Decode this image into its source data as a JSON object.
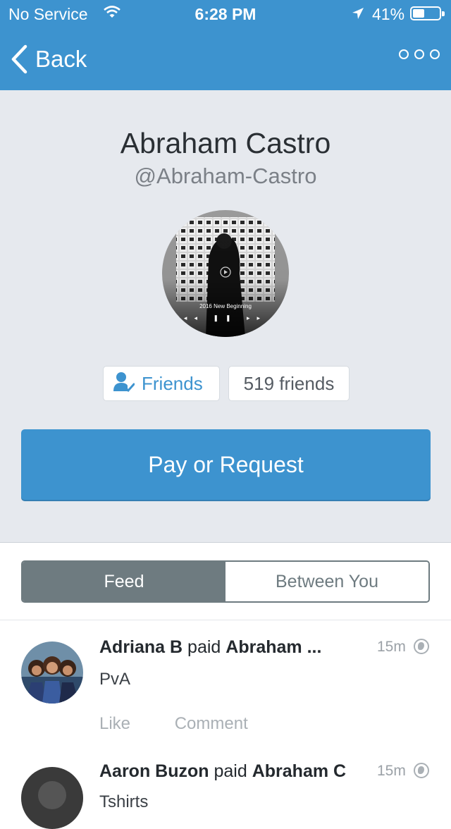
{
  "status_bar": {
    "carrier": "No Service",
    "time": "6:28 PM",
    "battery": "41%",
    "battery_level": 0.41
  },
  "nav": {
    "back_label": "Back",
    "more_icon": "more-options-icon"
  },
  "profile": {
    "name": "Abraham Castro",
    "username": "@Abraham-Castro",
    "photo_caption": "2016 New Beginning",
    "friends_button_label": "Friends",
    "friends_count_label": "519 friends"
  },
  "pay_button_label": "Pay or Request",
  "tabs": [
    {
      "label": "Feed",
      "active": true
    },
    {
      "label": "Between You",
      "active": false
    }
  ],
  "feed": [
    {
      "actor": "Adriana B",
      "verb": "paid",
      "target": "Abraham ...",
      "time": "15m",
      "note": "PvA",
      "like_label": "Like",
      "comment_label": "Comment"
    },
    {
      "actor": "Aaron Buzon",
      "verb": "paid",
      "target": "Abraham C",
      "time": "15m",
      "note": "Tshirts"
    }
  ],
  "colors": {
    "brand_blue": "#3d93cf",
    "profile_bg": "#e6e9ee",
    "tab_gray": "#6e7b80"
  }
}
